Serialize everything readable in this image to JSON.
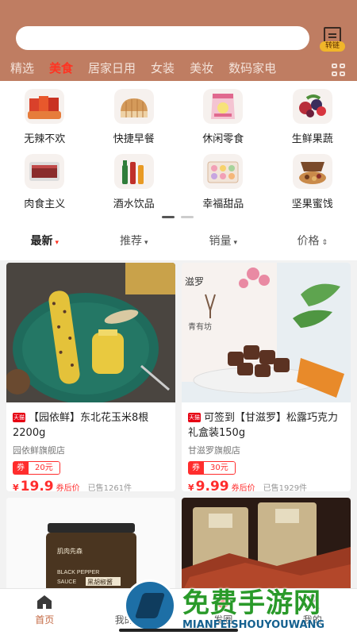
{
  "header": {
    "search_placeholder": "",
    "convert_label": "转链",
    "tabs": [
      {
        "label": "精选",
        "active": false
      },
      {
        "label": "美食",
        "active": true
      },
      {
        "label": "居家日用",
        "active": false
      },
      {
        "label": "女装",
        "active": false
      },
      {
        "label": "美妆",
        "active": false
      },
      {
        "label": "数码家电",
        "active": false
      }
    ]
  },
  "categories": [
    {
      "label": "无辣不欢",
      "icon": "spicy-snack-icon"
    },
    {
      "label": "快捷早餐",
      "icon": "bread-icon"
    },
    {
      "label": "休闲零食",
      "icon": "snack-bag-icon"
    },
    {
      "label": "生鲜果蔬",
      "icon": "fruit-icon"
    },
    {
      "label": "肉食主义",
      "icon": "meat-icon"
    },
    {
      "label": "酒水饮品",
      "icon": "drinks-icon"
    },
    {
      "label": "幸福甜品",
      "icon": "dessert-icon"
    },
    {
      "label": "坚果蜜饯",
      "icon": "nuts-icon"
    }
  ],
  "sort": [
    {
      "label": "最新",
      "caret": "▾",
      "active": true
    },
    {
      "label": "推荐",
      "caret": "▾",
      "active": false
    },
    {
      "label": "销量",
      "caret": "▾",
      "active": false
    },
    {
      "label": "价格",
      "caret": "⇕",
      "active": false
    }
  ],
  "products": [
    {
      "badge": "天猫",
      "title": "【园依鲜】东北花玉米8根2200g",
      "shop": "园依鲜旗舰店",
      "coupon_label": "券",
      "coupon_amount": "20元",
      "currency": "¥",
      "price": "19.9",
      "after_coupon": "券后价",
      "sold": "已售1261件"
    },
    {
      "badge": "天猫",
      "title": "可签到【甘滋罗】松露巧克力礼盒装150g",
      "shop": "甘滋罗旗舰店",
      "coupon_label": "券",
      "coupon_amount": "30元",
      "currency": "¥",
      "price": "9.99",
      "after_coupon": "券后价",
      "sold": "已售1929件"
    }
  ],
  "product_images": {
    "p1_box": "",
    "p2_text1": "滋罗",
    "p2_text2": "青有坊",
    "p3_brand": "肌肉先森",
    "p3_label1": "BLACK PEPPER",
    "p3_label2": "SAUCE",
    "p3_label3": "黑胡椒酱"
  },
  "bottom_nav": [
    {
      "label": "首页",
      "active": true
    },
    {
      "label": "我的分享",
      "active": false
    },
    {
      "label": "发圈",
      "active": false
    },
    {
      "label": "我的",
      "active": false
    }
  ],
  "watermark": {
    "title": "免费手游网",
    "subtitle": "MIANFEISHOUYOUWANG"
  },
  "colors": {
    "header_bg": "#bf7d62",
    "accent_red": "#ff2d2d",
    "active_tab": "#ff3322"
  }
}
